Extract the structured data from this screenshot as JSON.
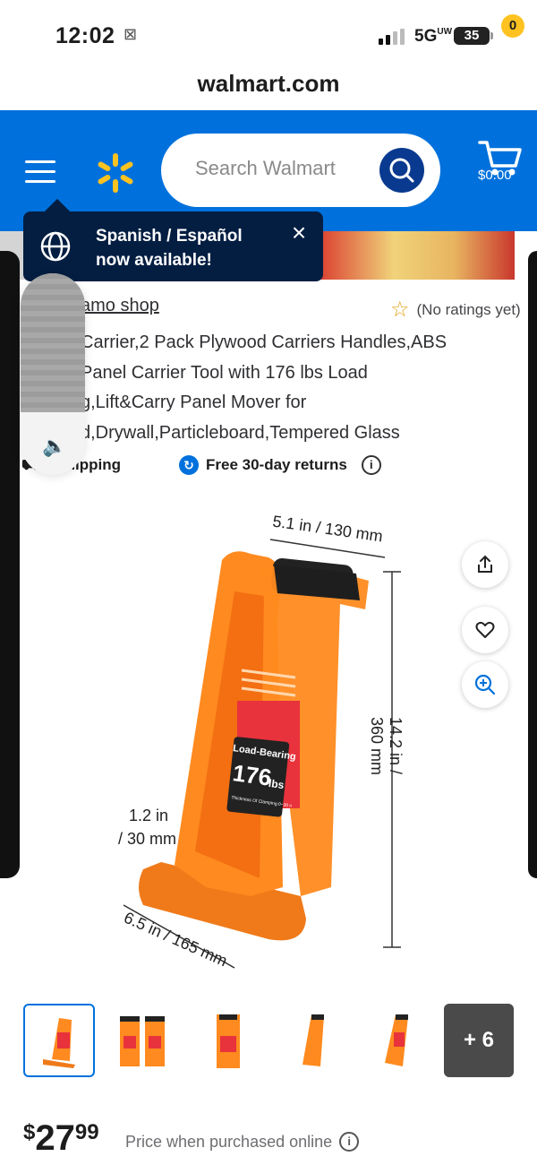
{
  "status_bar": {
    "time": "12:02",
    "network": "5G",
    "network_suffix": "UW",
    "battery": "35"
  },
  "browser": {
    "url": "walmart.com"
  },
  "header": {
    "search_placeholder": "Search Walmart",
    "cart_count": "0",
    "cart_total": "$0.00",
    "brand_color": "#0071dc",
    "spark_color": "#ffc220"
  },
  "toast": {
    "line1": "Spanish / Español",
    "line2": "now available!"
  },
  "product": {
    "shop_link": "amo shop",
    "rating_text": "(No ratings yet)",
    "title_lines": [
      " Carrier,2 Pack Plywood Carriers Handles,ABS",
      "Panel Carrier Tool with 176 lbs Load",
      "g,Lift&Carry Panel Mover for",
      "d,Drywall,Particleboard,Tempered Glass"
    ],
    "shipping": "e shipping",
    "returns": "Free 30-day returns",
    "image_labels": {
      "width_top": "5.1 in / 130 mm",
      "height": "14.2 in / 360 mm",
      "clamp_line1": "1.2 in",
      "clamp_line2": "/ 30 mm",
      "width_bottom": "6.5 in / 165 mm",
      "badge_title": "Load-Bearing",
      "badge_value": "176",
      "badge_unit": "lbs",
      "badge_sub": "Thickness Of Clamping:0~30 mm"
    },
    "more_images": "+ 6",
    "price": {
      "symbol": "$",
      "whole": "27",
      "cents": "99",
      "note": "Price when purchased online"
    }
  }
}
